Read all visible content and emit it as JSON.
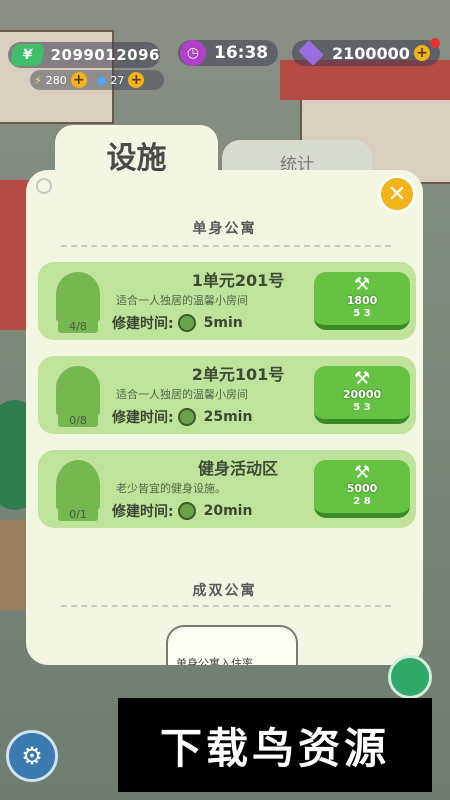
{
  "hud": {
    "money": "2099012096",
    "energy": "280",
    "water": "27",
    "time": "16:38",
    "gems": "2100000"
  },
  "tabs": {
    "facility": "设施",
    "stats": "统计"
  },
  "sections": [
    {
      "title": "单身公寓",
      "items": [
        {
          "name": "1单元201号",
          "desc": "适合一人独居的温馨小房间",
          "time_label": "修建时间:",
          "time": "5min",
          "count": "4/8",
          "cost": "1800",
          "res": "5  3"
        },
        {
          "name": "2单元101号",
          "desc": "适合一人独居的温馨小房间",
          "time_label": "修建时间:",
          "time": "25min",
          "count": "0/8",
          "cost": "20000",
          "res": "5  3"
        },
        {
          "name": "健身活动区",
          "desc": "老少皆宜的健身设施。",
          "time_label": "修建时间:",
          "time": "20min",
          "count": "0/1",
          "cost": "5000",
          "res": "2  8"
        }
      ]
    },
    {
      "title": "成双公寓",
      "sub_card": "单身公寓入住率"
    }
  ],
  "watermark": "下载鸟资源",
  "colors": {
    "card": "#bfe39a",
    "button": "#66c243",
    "close": "#f2b31b",
    "panel": "#f3f6e3"
  }
}
